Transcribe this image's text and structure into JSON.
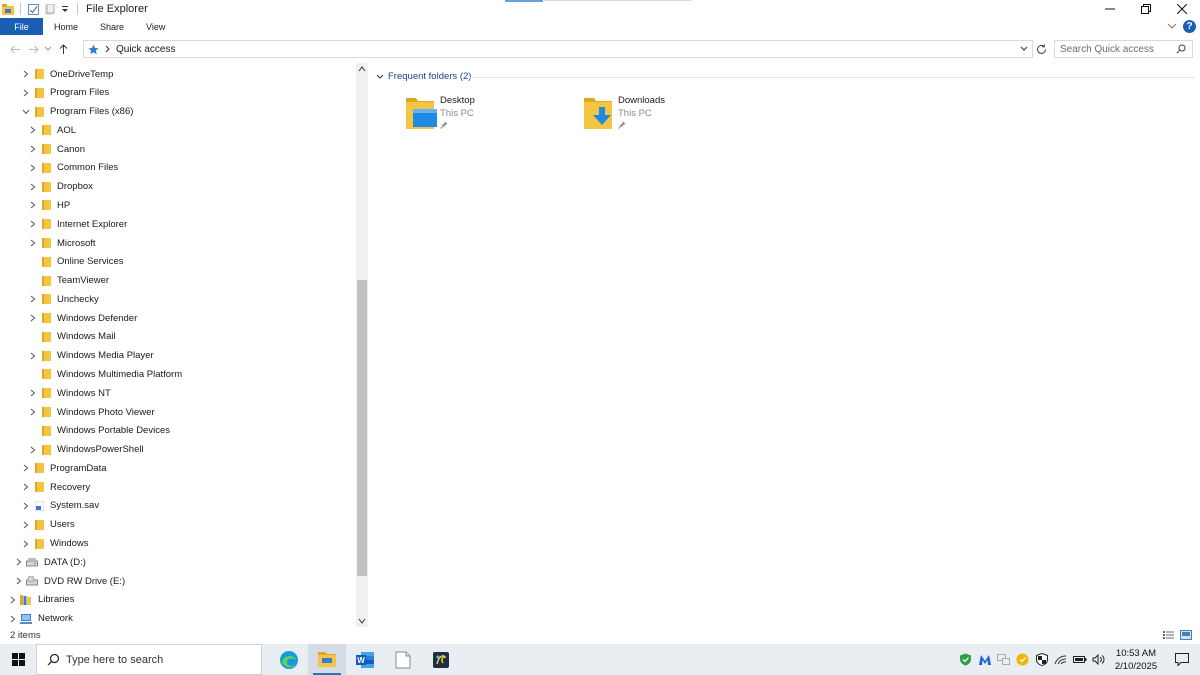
{
  "window": {
    "title": "File Explorer"
  },
  "ribbon": {
    "tabs": [
      "File",
      "Home",
      "Share",
      "View"
    ],
    "help": "?"
  },
  "address": {
    "location": "Quick access",
    "search_placeholder": "Search Quick access"
  },
  "nav_tree": [
    {
      "label": "OneDriveTemp",
      "indent": 2,
      "expander": "collapsed",
      "icon": "folder"
    },
    {
      "label": "Program Files",
      "indent": 2,
      "expander": "collapsed",
      "icon": "folder"
    },
    {
      "label": "Program Files (x86)",
      "indent": 2,
      "expander": "expanded",
      "icon": "folder"
    },
    {
      "label": "AOL",
      "indent": 3,
      "expander": "collapsed",
      "icon": "folder"
    },
    {
      "label": "Canon",
      "indent": 3,
      "expander": "collapsed",
      "icon": "folder"
    },
    {
      "label": "Common Files",
      "indent": 3,
      "expander": "collapsed",
      "icon": "folder"
    },
    {
      "label": "Dropbox",
      "indent": 3,
      "expander": "collapsed",
      "icon": "folder"
    },
    {
      "label": "HP",
      "indent": 3,
      "expander": "collapsed",
      "icon": "folder"
    },
    {
      "label": "Internet Explorer",
      "indent": 3,
      "expander": "collapsed",
      "icon": "folder"
    },
    {
      "label": "Microsoft",
      "indent": 3,
      "expander": "collapsed",
      "icon": "folder"
    },
    {
      "label": "Online Services",
      "indent": 3,
      "expander": "none",
      "icon": "folder"
    },
    {
      "label": "TeamViewer",
      "indent": 3,
      "expander": "none",
      "icon": "folder"
    },
    {
      "label": "Unchecky",
      "indent": 3,
      "expander": "collapsed",
      "icon": "folder"
    },
    {
      "label": "Windows Defender",
      "indent": 3,
      "expander": "collapsed",
      "icon": "folder"
    },
    {
      "label": "Windows Mail",
      "indent": 3,
      "expander": "none",
      "icon": "folder"
    },
    {
      "label": "Windows Media Player",
      "indent": 3,
      "expander": "collapsed",
      "icon": "folder"
    },
    {
      "label": "Windows Multimedia Platform",
      "indent": 3,
      "expander": "none",
      "icon": "folder"
    },
    {
      "label": "Windows NT",
      "indent": 3,
      "expander": "collapsed",
      "icon": "folder"
    },
    {
      "label": "Windows Photo Viewer",
      "indent": 3,
      "expander": "collapsed",
      "icon": "folder"
    },
    {
      "label": "Windows Portable Devices",
      "indent": 3,
      "expander": "none",
      "icon": "folder"
    },
    {
      "label": "WindowsPowerShell",
      "indent": 3,
      "expander": "collapsed",
      "icon": "folder"
    },
    {
      "label": "ProgramData",
      "indent": 2,
      "expander": "collapsed",
      "icon": "folder"
    },
    {
      "label": "Recovery",
      "indent": 2,
      "expander": "collapsed",
      "icon": "folder"
    },
    {
      "label": "System.sav",
      "indent": 2,
      "expander": "collapsed",
      "icon": "special-folder"
    },
    {
      "label": "Users",
      "indent": 2,
      "expander": "collapsed",
      "icon": "folder"
    },
    {
      "label": "Windows",
      "indent": 2,
      "expander": "collapsed",
      "icon": "folder"
    },
    {
      "label": "DATA (D:)",
      "indent": 1,
      "expander": "collapsed",
      "icon": "drive"
    },
    {
      "label": "DVD RW Drive (E:)",
      "indent": 1,
      "expander": "collapsed",
      "icon": "dvd"
    },
    {
      "label": "Libraries",
      "indent": 0,
      "expander": "collapsed",
      "icon": "library"
    },
    {
      "label": "Network",
      "indent": 0,
      "expander": "collapsed",
      "icon": "network"
    }
  ],
  "content": {
    "group_label": "Frequent folders (2)",
    "folders": [
      {
        "name": "Desktop",
        "location": "This PC",
        "icon": "desktop-folder"
      },
      {
        "name": "Downloads",
        "location": "This PC",
        "icon": "downloads-folder"
      }
    ]
  },
  "status": {
    "item_count": "2 items"
  },
  "taskbar": {
    "search_placeholder": "Type here to search",
    "apps": [
      "edge",
      "file-explorer",
      "word",
      "notepad",
      "app-icon"
    ],
    "clock_time": "10:53 AM",
    "clock_date": "2/10/2025"
  },
  "colors": {
    "accent": "#1a5fb4",
    "folder": "#f4c542",
    "group_header": "#1e3f8f",
    "taskbar": "#e8eef2"
  }
}
